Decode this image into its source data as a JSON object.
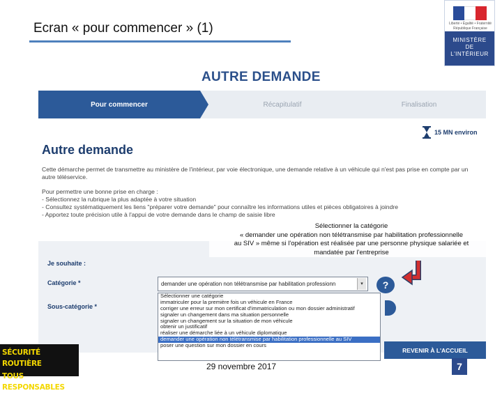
{
  "slide": {
    "title": "Ecran « pour commencer » (1)",
    "date": "29 novembre 2017",
    "page_number": "7"
  },
  "logo": {
    "motto": "Liberté • Égalité • Fraternité République Française",
    "ministry_lines": [
      "MINISTÈRE",
      "DE",
      "L'INTÉRIEUR"
    ]
  },
  "road_safety": {
    "line1": "SÉCURITÉ ROUTIÈRE",
    "line2": "TOUS RESPONSABLES"
  },
  "page": {
    "heading": "AUTRE DEMANDE",
    "steps": [
      "Pour commencer",
      "Récapitulatif",
      "Finalisation"
    ],
    "duration": "15 MN environ",
    "content_title": "Autre demande",
    "intro_1": "Cette démarche permet de transmettre au ministère de l'intérieur, par voie électronique, une demande relative à un véhicule qui n'est pas prise en compte par un autre téléservice.",
    "intro_2_lines": [
      "Pour permettre une bonne prise en charge :",
      "- Sélectionnez la rubrique la plus adaptée à votre situation",
      "- Consultez systématiquement les liens \"préparer votre demande\" pour connaître les informations utiles et pièces obligatoires à joindre",
      "- Apportez toute précision utile à l'appui de votre demande dans le champ de saisie libre"
    ]
  },
  "annotation": {
    "lines": [
      "Sélectionner la catégorie",
      "« demander une opération non télétransmise  par habilitation professionnelle",
      "au SIV » même si l'opération est réalisée par une personne physique  salariée et",
      "mandatée par l'entreprise"
    ]
  },
  "form": {
    "wish_label": "Je souhaite :",
    "category_label": "Catégorie *",
    "subcategory_label": "Sous-catégorie *",
    "category_value": "demander une opération non télétransmise par habilitation professionn",
    "help_label": "?",
    "dropdown_options": [
      "Sélectionner une catégorie",
      "immatriculer pour la première fois un véhicule en France",
      "corriger une erreur sur mon certificat d'immatriculation ou mon dossier administratif",
      "signaler un changement dans ma situation personnelle",
      "signaler un changement sur la situation de mon véhicule",
      "obtenir un justificatif",
      "réaliser une démarche liée à un véhicule diplomatique",
      "demander une opération non télétransmise par habilitation professionnelle au SIV",
      "poser une question sur mon dossier en cours"
    ],
    "selected_option_index": 7,
    "return_button": "REVENIR À L'ACCUEIL"
  },
  "colors": {
    "primary_blue": "#2c5a99",
    "annotation_arrow": "#d32f2f"
  }
}
